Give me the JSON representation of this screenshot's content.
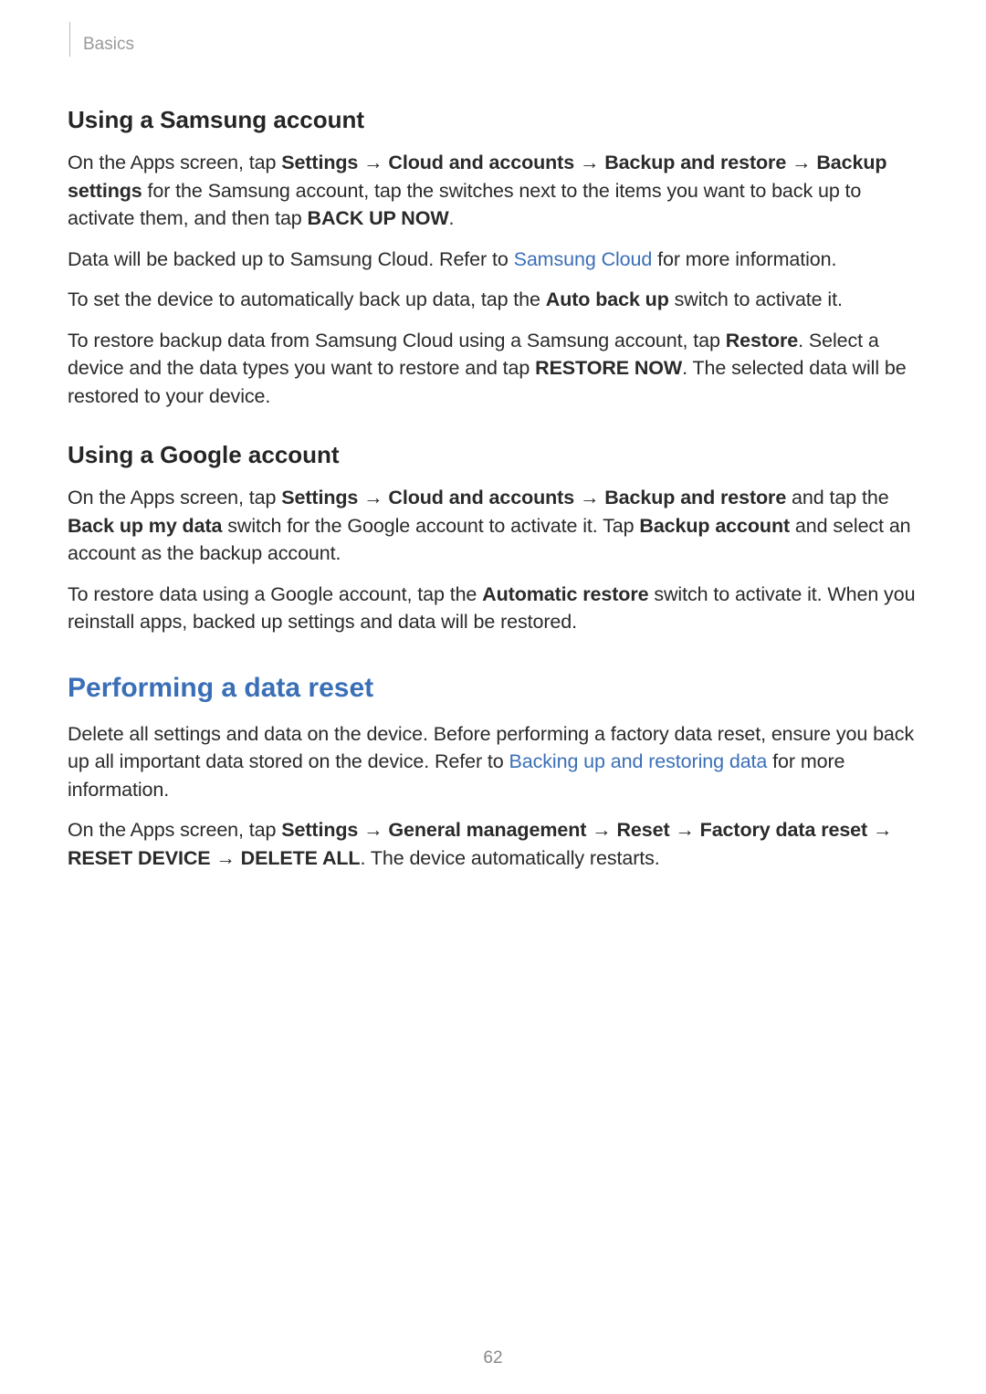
{
  "header": {
    "section": "Basics"
  },
  "s1": {
    "title": "Using a Samsung account",
    "p1_a": "On the Apps screen, tap ",
    "p1_b": "Settings",
    "p1_c": "Cloud and accounts",
    "p1_d": "Backup and restore",
    "p1_e": "Backup settings",
    "p1_f": " for the Samsung account, tap the switches next to the items you want to back up to activate them, and then tap ",
    "p1_g": "BACK UP NOW",
    "p1_h": ".",
    "p2_a": "Data will be backed up to Samsung Cloud. Refer to ",
    "p2_link": "Samsung Cloud",
    "p2_b": " for more information.",
    "p3_a": "To set the device to automatically back up data, tap the ",
    "p3_b": "Auto back up",
    "p3_c": " switch to activate it.",
    "p4_a": "To restore backup data from Samsung Cloud using a Samsung account, tap ",
    "p4_b": "Restore",
    "p4_c": ". Select a device and the data types you want to restore and tap ",
    "p4_d": "RESTORE NOW",
    "p4_e": ". The selected data will be restored to your device."
  },
  "s2": {
    "title": "Using a Google account",
    "p1_a": "On the Apps screen, tap ",
    "p1_b": "Settings",
    "p1_c": "Cloud and accounts",
    "p1_d": "Backup and restore",
    "p1_e": " and tap the ",
    "p1_f": "Back up my data",
    "p1_g": " switch for the Google account to activate it. Tap ",
    "p1_h": "Backup account",
    "p1_i": " and select an account as the backup account.",
    "p2_a": "To restore data using a Google account, tap the ",
    "p2_b": "Automatic restore",
    "p2_c": " switch to activate it. When you reinstall apps, backed up settings and data will be restored."
  },
  "s3": {
    "title": "Performing a data reset",
    "p1_a": "Delete all settings and data on the device. Before performing a factory data reset, ensure you back up all important data stored on the device. Refer to ",
    "p1_link": "Backing up and restoring data",
    "p1_b": " for more information.",
    "p2_a": "On the Apps screen, tap ",
    "p2_b": "Settings",
    "p2_c": "General management",
    "p2_d": "Reset",
    "p2_e": "Factory data reset",
    "p2_f": "RESET DEVICE",
    "p2_g": "DELETE ALL",
    "p2_h": ". The device automatically restarts."
  },
  "arrow": " → ",
  "page_number": "62"
}
